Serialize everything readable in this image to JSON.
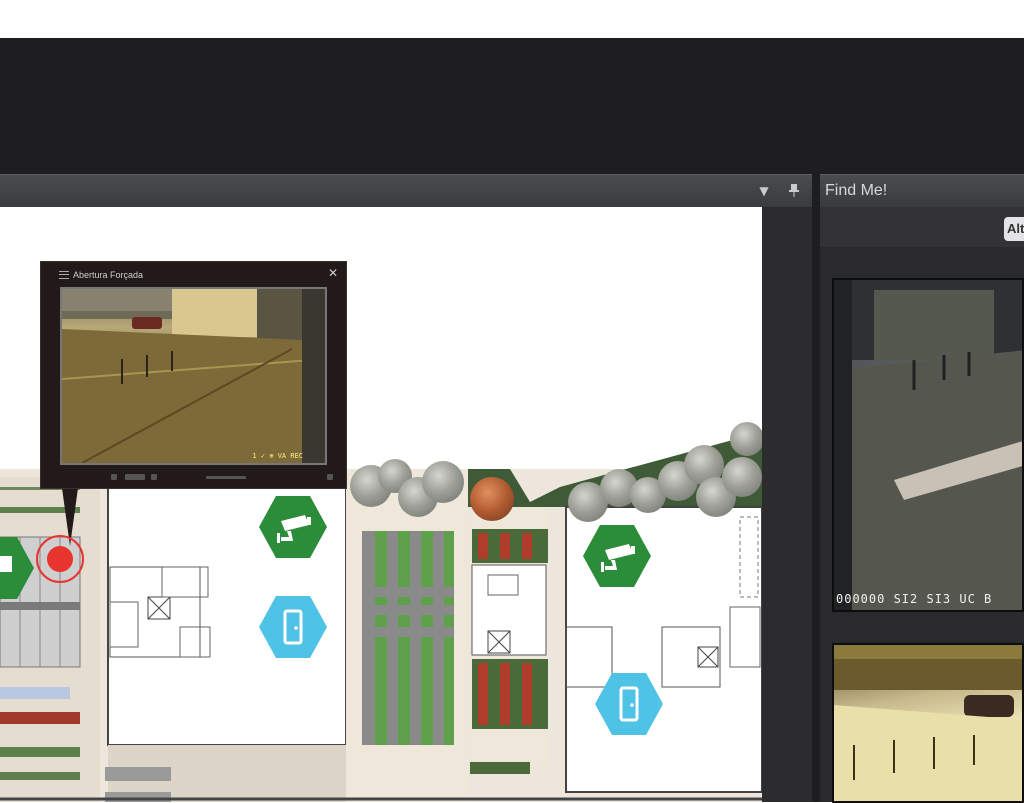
{
  "map_panel": {
    "dropdown_icon": "chevron-down-icon",
    "pin_icon": "pin-icon"
  },
  "popup": {
    "title": "Abertura Forçada",
    "osd": "1 ✓ ⊕ VA REC",
    "close_glyph": "✕"
  },
  "findme": {
    "title": "Find Me!",
    "alt_button": "Alt",
    "cam1_timestamp": "000000 SI2 SI3 UC B"
  },
  "colors": {
    "camera_hex": "#2b8c3a",
    "door_hex": "#4ec3e6",
    "alarm_marker": "#e8342f",
    "toolbar_bg": "#1e1d1f"
  }
}
